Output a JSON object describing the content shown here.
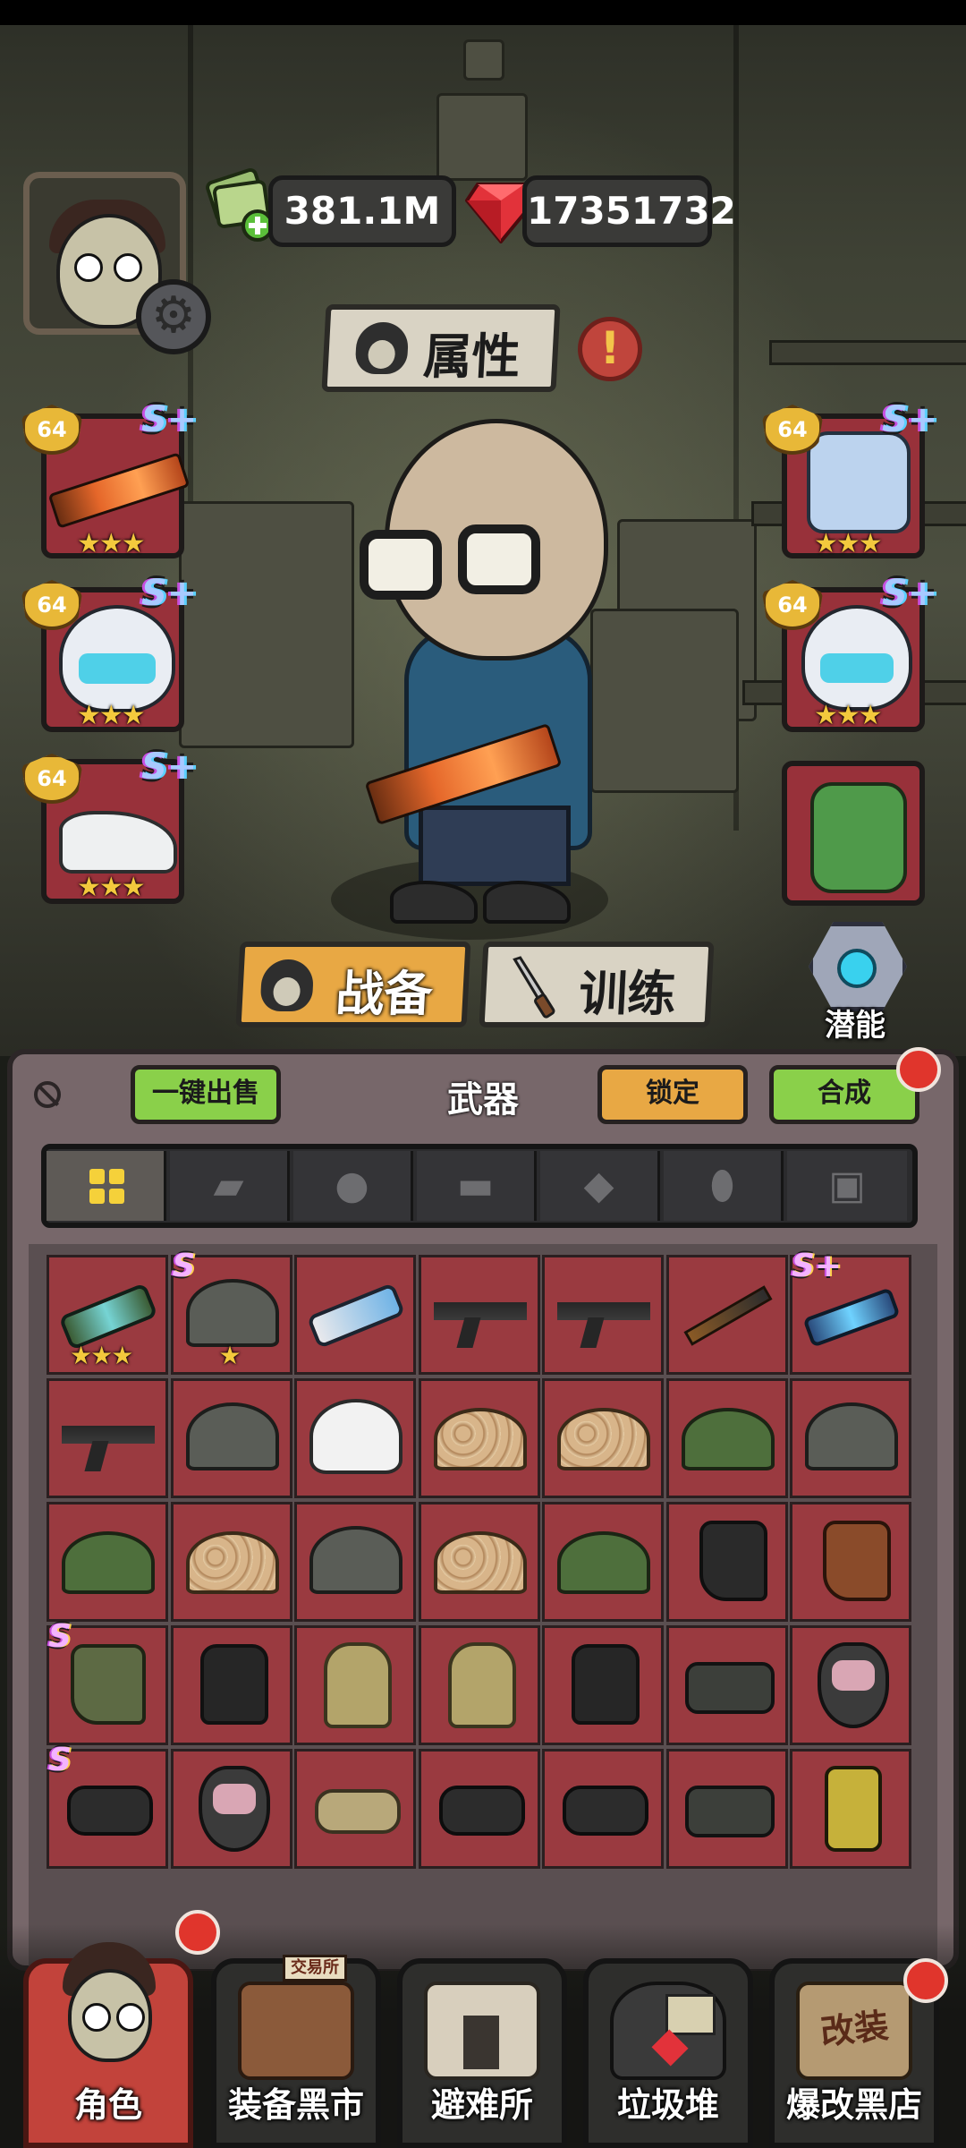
{
  "currency": {
    "cash": "381.1M",
    "gems": "17351732"
  },
  "header": {
    "attr_label": "属性",
    "alert_mark": "!"
  },
  "equipment": {
    "left": [
      {
        "slot": "weapon",
        "level": "64",
        "grade": "S+",
        "stars": 3,
        "icon": "assault-rifle-icon"
      },
      {
        "slot": "helmet",
        "level": "64",
        "grade": "S+",
        "stars": 3,
        "icon": "tactical-helmet-icon"
      },
      {
        "slot": "shoes",
        "level": "64",
        "grade": "S+",
        "stars": 3,
        "icon": "sneaker-icon"
      }
    ],
    "right": [
      {
        "slot": "armor",
        "level": "64",
        "grade": "S+",
        "stars": 3,
        "icon": "body-armor-icon"
      },
      {
        "slot": "mask",
        "level": "64",
        "grade": "S+",
        "stars": 3,
        "icon": "space-helmet-icon"
      },
      {
        "slot": "backpack",
        "icon": "backpack-icon"
      }
    ]
  },
  "tabs": {
    "gear": "战备",
    "training": "训练",
    "potential": "潜能"
  },
  "inventory": {
    "sell_all": "一键出售",
    "category": "武器",
    "lock": "锁定",
    "merge": "合成",
    "filters": [
      "all-icon",
      "weapon-icon",
      "helmet-icon",
      "pants-icon",
      "armor-icon",
      "mask-icon",
      "backpack-icon"
    ],
    "items": [
      [
        "launcher",
        "helmet-dark",
        "smg",
        "rifle",
        "rifle",
        "sniper",
        "gun-blue"
      ],
      [
        "rifle",
        "helmet-dark",
        "helmet-white",
        "helmet-camo",
        "helmet-camo",
        "helmet-green",
        "helmet-dark"
      ],
      [
        "helmet-green",
        "helmet-camo",
        "helmet-dark",
        "helmet-camo",
        "helmet-green",
        "boot-black",
        "boot-brown"
      ],
      [
        "boot-camo",
        "vest",
        "suit",
        "suit",
        "vest",
        "scope",
        "mask"
      ],
      [
        "nv",
        "mask",
        "nv-tan",
        "nv",
        "nv",
        "scope",
        "radio"
      ]
    ],
    "badges": [
      {
        "row": 0,
        "col": 0,
        "stars": 3
      },
      {
        "row": 0,
        "col": 1,
        "grade": "S",
        "stars": 1
      },
      {
        "row": 0,
        "col": 6,
        "grade": "S+"
      },
      {
        "row": 3,
        "col": 0,
        "grade": "S"
      },
      {
        "row": 4,
        "col": 0,
        "grade": "S"
      }
    ]
  },
  "nav": {
    "items": [
      {
        "label": "角色",
        "active": true,
        "badge": true
      },
      {
        "label": "装备黑市",
        "sign": "交易所"
      },
      {
        "label": "避难所"
      },
      {
        "label": "垃圾堆"
      },
      {
        "label": "爆改黑店",
        "badge": true,
        "sign": "改装"
      }
    ]
  },
  "colors": {
    "slot_red": "#98313a",
    "accent_green": "#8ad04a",
    "accent_orange": "#e8a844",
    "gold": "#e8b838",
    "alert_red": "#e0352c"
  }
}
